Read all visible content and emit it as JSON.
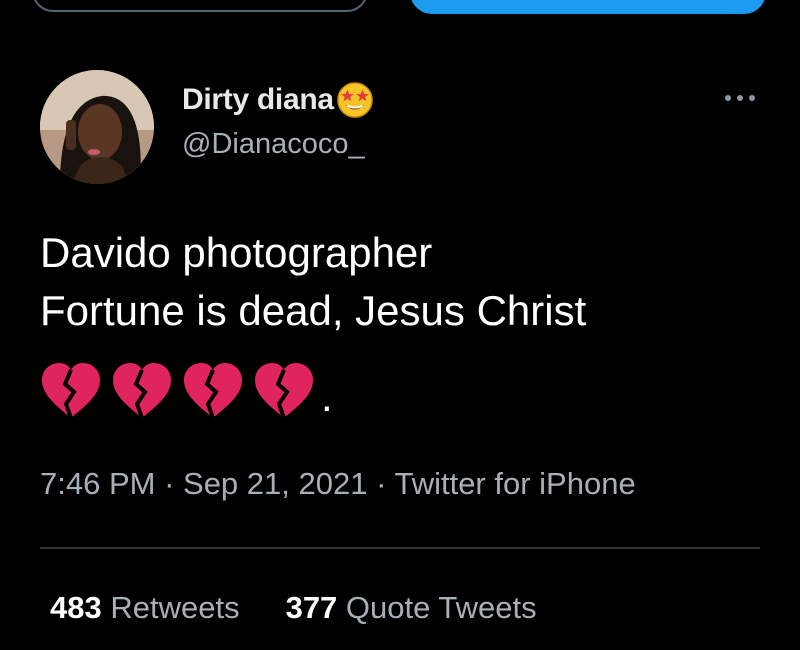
{
  "user": {
    "display_name": "Dirty diana",
    "handle": "@Dianacoco_",
    "name_emoji": "star-struck-emoji"
  },
  "tweet": {
    "text_line1": "Davido photographer",
    "text_line2": "Fortune is dead, Jesus Christ",
    "emoji": [
      "broken-heart-emoji",
      "broken-heart-emoji",
      "broken-heart-emoji",
      "broken-heart-emoji"
    ],
    "text_end": ".",
    "time": "7:46 PM",
    "sep1": " · ",
    "date": "Sep 21, 2021",
    "sep2": " · ",
    "source": "Twitter for iPhone"
  },
  "stats": {
    "retweets_count": "483",
    "retweets_label": " Retweets",
    "quotes_count": "377",
    "quotes_label": " Quote Tweets"
  },
  "icons": {
    "more": "more-horizontal-icon"
  },
  "colors": {
    "background": "#000000",
    "primary_text": "#ffffff",
    "secondary_text": "#a8b0b7",
    "accent": "#1d9bf0",
    "divider": "#2f3336",
    "heart": "#e0245e"
  }
}
